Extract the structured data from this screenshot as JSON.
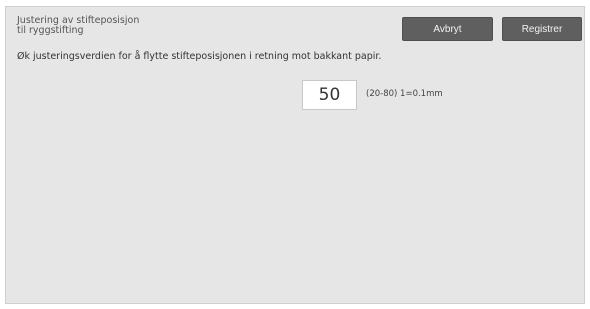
{
  "header": {
    "title_line1": "Justering av stifteposisjon",
    "title_line2": "til ryggstifting",
    "cancel_label": "Avbryt",
    "register_label": "Registrer"
  },
  "main": {
    "instruction": "Øk justeringsverdien for å flytte stifteposisjonen i retning mot bakkant papir.",
    "value": "50",
    "range_note": "(20-80) 1=0.1mm"
  }
}
